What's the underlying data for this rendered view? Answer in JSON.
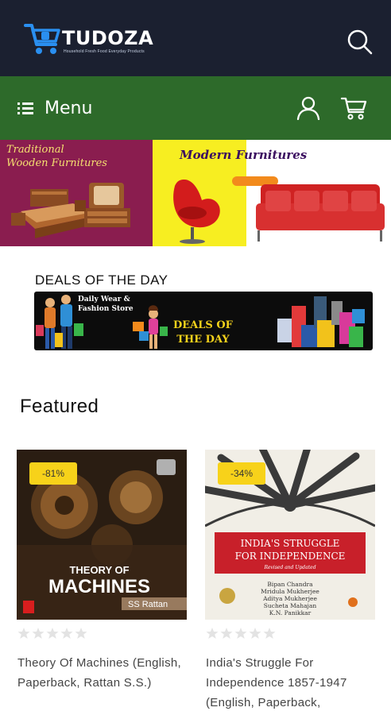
{
  "header": {
    "logo_text": "TUDOZA",
    "logo_tagline": "Household Fresh Food Everyday Products"
  },
  "menubar": {
    "menu_label": "Menu"
  },
  "banner": {
    "left_title": "Traditional\nWooden Furnitures",
    "right_title": "Modern Furnitures"
  },
  "deals": {
    "section_title": "DEALS OF THE DAY",
    "banner_small_text": "Daily Wear &\nFashion Store",
    "banner_big_text": "DEALS OF\nTHE DAY"
  },
  "featured": {
    "section_title": "Featured",
    "products": [
      {
        "discount": "-81%",
        "title": "Theory Of Machines (English, Paperback, Rattan S.S.)",
        "cover_title": "THEORY OF",
        "cover_title_big": "MACHINES",
        "cover_author": "SS Rattan",
        "rating": 0,
        "rating_max": 5
      },
      {
        "discount": "-34%",
        "title": "India's Struggle For Independence 1857-1947 (English, Paperback,",
        "cover_title": "INDIA'S STRUGGLE",
        "cover_title_2": "FOR INDEPENDENCE",
        "cover_subtitle": "Revised and Updated",
        "cover_authors": [
          "Bipan Chandra",
          "Mridula Mukherjee",
          "Aditya Mukherjee",
          "Sucheta Mahajan",
          "K.N. Panikkar"
        ],
        "rating": 0,
        "rating_max": 5
      }
    ]
  },
  "colors": {
    "header_bg": "#1b2030",
    "menubar_bg": "#2d6a2a",
    "discount_badge": "#f7d21a",
    "star_empty": "#e3e3e3"
  },
  "icons": [
    "cart-logo-icon",
    "search-icon",
    "menu-icon",
    "user-icon",
    "cart-icon",
    "star-icon"
  ]
}
